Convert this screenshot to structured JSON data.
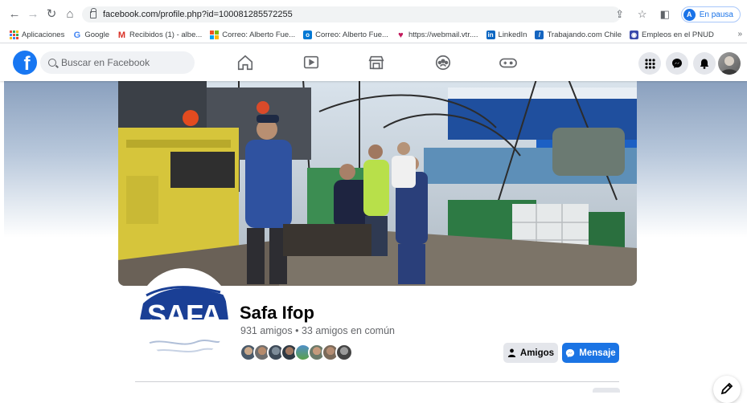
{
  "browser": {
    "url": "facebook.com/profile.php?id=100081285572255",
    "profile_initial": "A",
    "profile_status": "En pausa"
  },
  "bookmarks": [
    {
      "label": "Aplicaciones",
      "icon": "apps-grid-icon",
      "color": "#ea4335"
    },
    {
      "label": "Google",
      "icon": "google-icon",
      "color": "#4285f4"
    },
    {
      "label": "Recibidos (1) - albe...",
      "icon": "gmail-icon",
      "color": "#d93025"
    },
    {
      "label": "Correo: Alberto Fue...",
      "icon": "office-icon",
      "color": "#f25022"
    },
    {
      "label": "Correo: Alberto Fue...",
      "icon": "outlook-icon",
      "color": "#0078d4"
    },
    {
      "label": "https://webmail.vtr....",
      "icon": "vtr-icon",
      "color": "#c2185b"
    },
    {
      "label": "LinkedIn",
      "icon": "linkedin-icon",
      "color": "#0a66c2"
    },
    {
      "label": "Trabajando.com Chile",
      "icon": "trabajando-icon",
      "color": "#1565c0"
    },
    {
      "label": "Empleos en el PNUD",
      "icon": "pnud-icon",
      "color": "#3949ab"
    }
  ],
  "facebook": {
    "logo": "f",
    "search_placeholder": "Buscar en Facebook",
    "brand_color": "#1877f2"
  },
  "profile": {
    "name": "Safa Ifop",
    "friends_summary": "931 amigos • 33 amigos en común",
    "avatar_text": "SAFA",
    "friend_button": "Amigos",
    "message_button": "Mensaje"
  }
}
